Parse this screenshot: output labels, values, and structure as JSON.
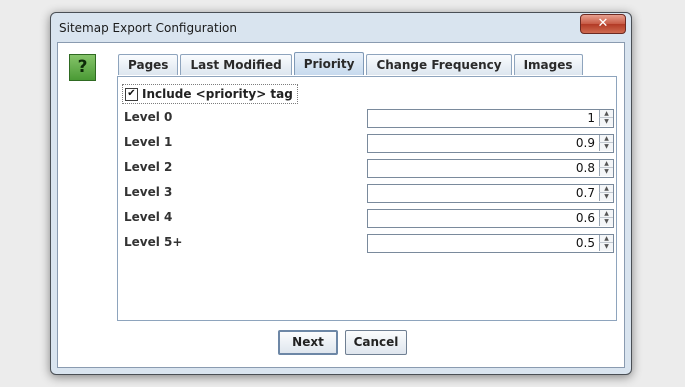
{
  "window": {
    "title": "Sitemap Export Configuration",
    "close_glyph": "✕"
  },
  "help": {
    "glyph": "?",
    "icon": "help-icon"
  },
  "tabs": [
    {
      "label": "Pages",
      "selected": false
    },
    {
      "label": "Last Modified",
      "selected": false
    },
    {
      "label": "Priority",
      "selected": true
    },
    {
      "label": "Change Frequency",
      "selected": false
    },
    {
      "label": "Images",
      "selected": false
    }
  ],
  "priority": {
    "include_label": "Include <priority> tag",
    "include_checked": true,
    "check_glyph": "✔",
    "levels": [
      {
        "label": "Level 0",
        "value": "1"
      },
      {
        "label": "Level 1",
        "value": "0.9"
      },
      {
        "label": "Level 2",
        "value": "0.8"
      },
      {
        "label": "Level 3",
        "value": "0.7"
      },
      {
        "label": "Level 4",
        "value": "0.6"
      },
      {
        "label": "Level 5+",
        "value": "0.5"
      }
    ]
  },
  "buttons": {
    "next_label": "Next",
    "cancel_label": "Cancel"
  },
  "colors": {
    "window_frame": "#d9e4ef",
    "close_button": "#c75a45",
    "help_icon": "#4a9a35",
    "selected_tab": "#c7daee"
  }
}
